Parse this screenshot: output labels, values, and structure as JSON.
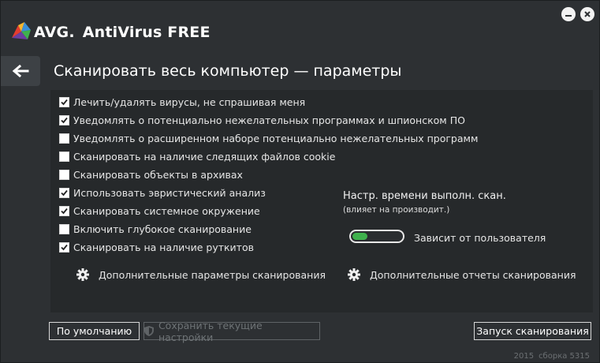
{
  "app": {
    "brand_prefix": "AVG.",
    "brand_product": "AntiVirus FREE",
    "window_buttons": [
      "minimize-icon",
      "close-icon"
    ]
  },
  "page": {
    "title": "Сканировать весь компьютер — параметры",
    "back_icon": "arrow-left-icon"
  },
  "options": [
    {
      "label": "Лечить/удалять вирусы, не спрашивая меня",
      "checked": true
    },
    {
      "label": "Уведомлять о потенциально нежелательных программах и шпионском ПО",
      "checked": true
    },
    {
      "label": "Уведомлять о расширенном наборе потенциально нежелательных программ",
      "checked": false
    },
    {
      "label": "Сканировать на наличие следящих файлов cookie",
      "checked": false
    },
    {
      "label": "Сканировать объекты в архивах",
      "checked": false
    },
    {
      "label": "Использовать эвристический анализ",
      "checked": true
    },
    {
      "label": "Сканировать системное окружение",
      "checked": true
    },
    {
      "label": "Включить глубокое сканирование",
      "checked": false
    },
    {
      "label": "Сканировать на наличие руткитов",
      "checked": true
    }
  ],
  "schedule": {
    "title": "Настр. времени выполн. скан.",
    "subtitle": "(влияет на производит.)",
    "slider_label": "Зависит от пользователя",
    "slider_level": 0.3,
    "slider_color": "#3fb14d"
  },
  "links": {
    "advanced": "Дополнительные параметры сканирования",
    "reports": "Дополнительные отчеты сканирования",
    "icon": "gear-icon"
  },
  "buttons": {
    "defaults": "По умолчанию",
    "save": "Сохранить текущие настройки",
    "start": "Запуск сканирования"
  },
  "version": {
    "year": "2015",
    "build": "сборка 5315"
  },
  "colors": {
    "background": "#2d3033",
    "panel": "#26292b",
    "accent_green": "#3fb14d"
  }
}
